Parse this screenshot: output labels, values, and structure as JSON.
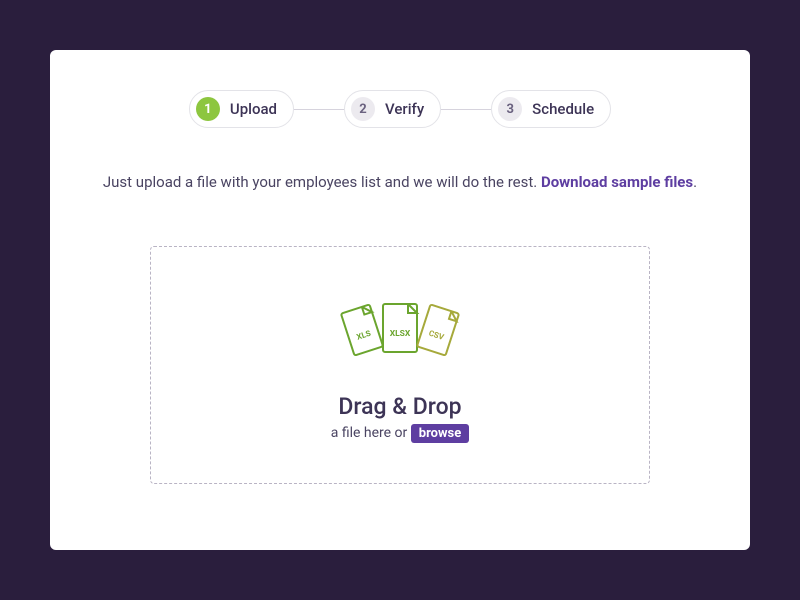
{
  "stepper": {
    "steps": [
      {
        "num": "1",
        "label": "Upload",
        "active": true
      },
      {
        "num": "2",
        "label": "Verify",
        "active": false
      },
      {
        "num": "3",
        "label": "Schedule",
        "active": false
      }
    ]
  },
  "instructions": {
    "text": "Just upload a file with your employees list and we will do the rest. ",
    "link": "Download sample files",
    "period": "."
  },
  "dropzone": {
    "icons": [
      "XLS",
      "XLSX",
      "CSV"
    ],
    "title": "Drag & Drop",
    "sub_prefix": "a file here or ",
    "browse": "browse"
  },
  "colors": {
    "icon_green": "#6ba52e",
    "icon_olive": "#a6a93b"
  }
}
